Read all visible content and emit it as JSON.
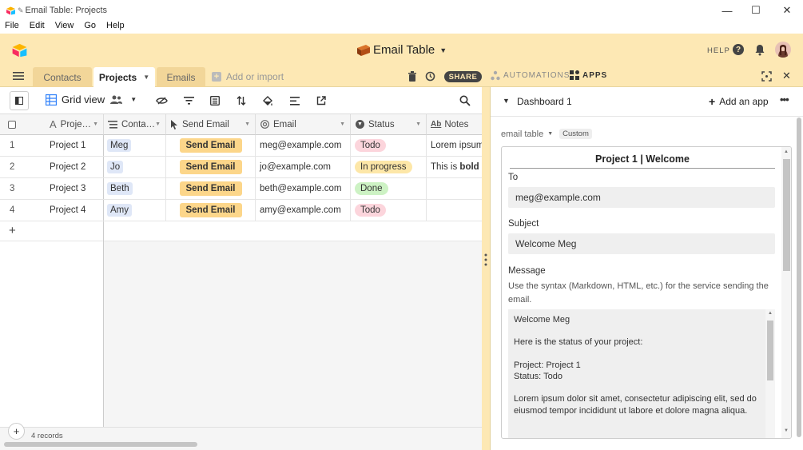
{
  "window": {
    "title": "Email Table: Projects",
    "controls": {
      "minimize": "—",
      "maximize": "☐",
      "close": "✕"
    }
  },
  "menu": [
    "File",
    "Edit",
    "View",
    "Go",
    "Help"
  ],
  "header": {
    "base_name": "Email Table",
    "help_label": "HELP",
    "accent": "#fde8b4"
  },
  "tabs": [
    {
      "label": "Contacts"
    },
    {
      "label": "Projects"
    },
    {
      "label": "Emails"
    }
  ],
  "add_import_label": "Add or import",
  "share_label": "SHARE",
  "automations_label": "AUTOMATIONS",
  "apps_label": "APPS",
  "toolbar": {
    "view_name": "Grid view"
  },
  "grid": {
    "columns": [
      "Proje…",
      "Conta…",
      "Send Email",
      "Email",
      "Status",
      "Notes"
    ],
    "rows": [
      {
        "num": "1",
        "project": "Project 1",
        "contact": "Meg",
        "send": "Send Email",
        "email": "meg@example.com",
        "status": "Todo",
        "notes_a": "Lorem ipsum",
        "notes_b": ""
      },
      {
        "num": "2",
        "project": "Project 2",
        "contact": "Jo",
        "send": "Send Email",
        "email": "jo@example.com",
        "status": "In progress",
        "notes_a": "This is ",
        "notes_b": "bold te"
      },
      {
        "num": "3",
        "project": "Project 3",
        "contact": "Beth",
        "send": "Send Email",
        "email": "beth@example.com",
        "status": "Done",
        "notes_a": "",
        "notes_b": ""
      },
      {
        "num": "4",
        "project": "Project 4",
        "contact": "Amy",
        "send": "Send Email",
        "email": "amy@example.com",
        "status": "Todo",
        "notes_a": "",
        "notes_b": ""
      }
    ],
    "add_row": "+",
    "record_count": "4 records",
    "status_colors": {
      "Todo": "#fcd5dc",
      "In progress": "#fde7a8",
      "Done": "#cdf2c4"
    }
  },
  "panel": {
    "dashboard_title": "Dashboard 1",
    "add_app_label": "Add an app",
    "app_name": "email table",
    "app_badge": "Custom",
    "email_heading": "Project 1 | Welcome",
    "to_label": "To",
    "to_value": "meg@example.com",
    "subject_label": "Subject",
    "subject_value": "Welcome Meg",
    "message_label": "Message",
    "message_hint": "Use the syntax (Markdown, HTML, etc.) for the service sending the email.",
    "message_body": "Welcome Meg\n\nHere is the status of your project:\n\nProject: Project 1\nStatus: Todo\n\nLorem ipsum dolor sit amet, consectetur adipiscing elit, sed do eiusmod tempor incididunt ut labore et dolore magna aliqua."
  }
}
